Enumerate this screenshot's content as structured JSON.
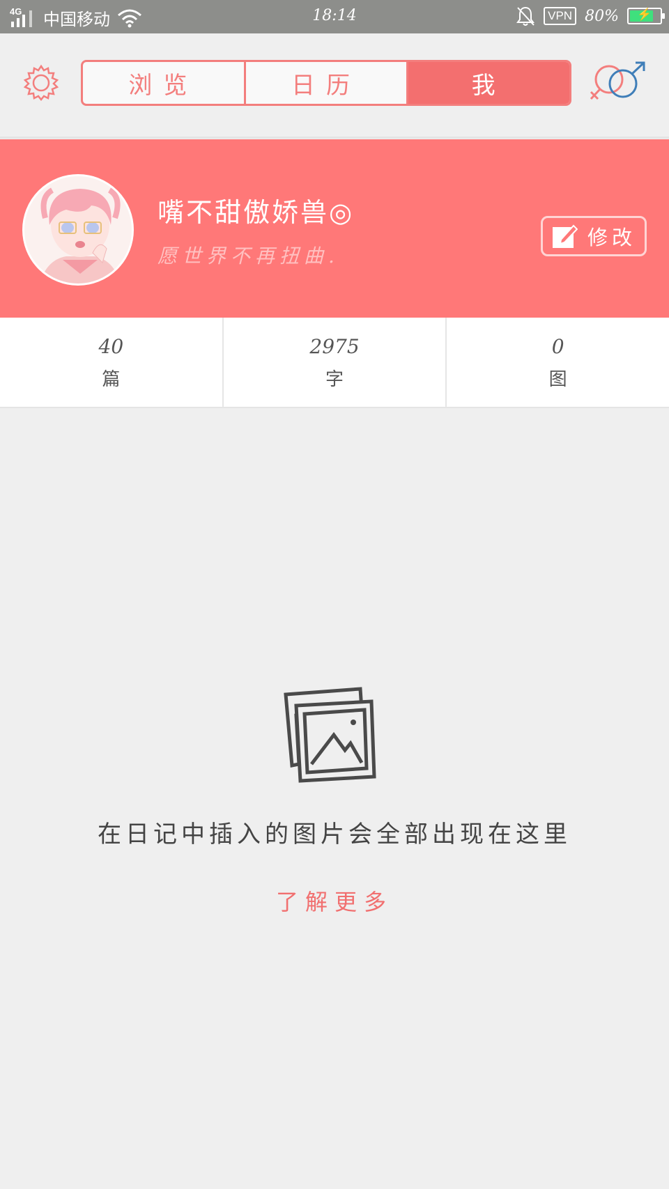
{
  "status_bar": {
    "network": "4G",
    "carrier": "中国移动",
    "time": "18:14",
    "vpn": "VPN",
    "battery": "80%",
    "battery_level": 0.8,
    "icons": [
      "signal-icon",
      "wifi-icon",
      "mute-bell-icon",
      "battery-icon",
      "charging-icon"
    ]
  },
  "header": {
    "tabs": [
      {
        "label": "浏览",
        "active": false
      },
      {
        "label": "日历",
        "active": false
      },
      {
        "label": "我",
        "active": true
      }
    ],
    "icons": [
      "gear-icon",
      "gender-icon"
    ],
    "accent_color": "#f36f6f",
    "male_color": "#3f7eb8"
  },
  "profile": {
    "nickname": "嘴不甜傲娇兽◎",
    "motto": "愿世界不再扭曲.",
    "edit_label": "修改",
    "background_color": "#ff7878"
  },
  "stats": [
    {
      "value": "40",
      "label": "篇"
    },
    {
      "value": "2975",
      "label": "字"
    },
    {
      "value": "0",
      "label": "图"
    }
  ],
  "empty_state": {
    "icon": "photos-icon",
    "message": "在日记中插入的图片会全部出现在这里",
    "link_label": "了解更多"
  }
}
